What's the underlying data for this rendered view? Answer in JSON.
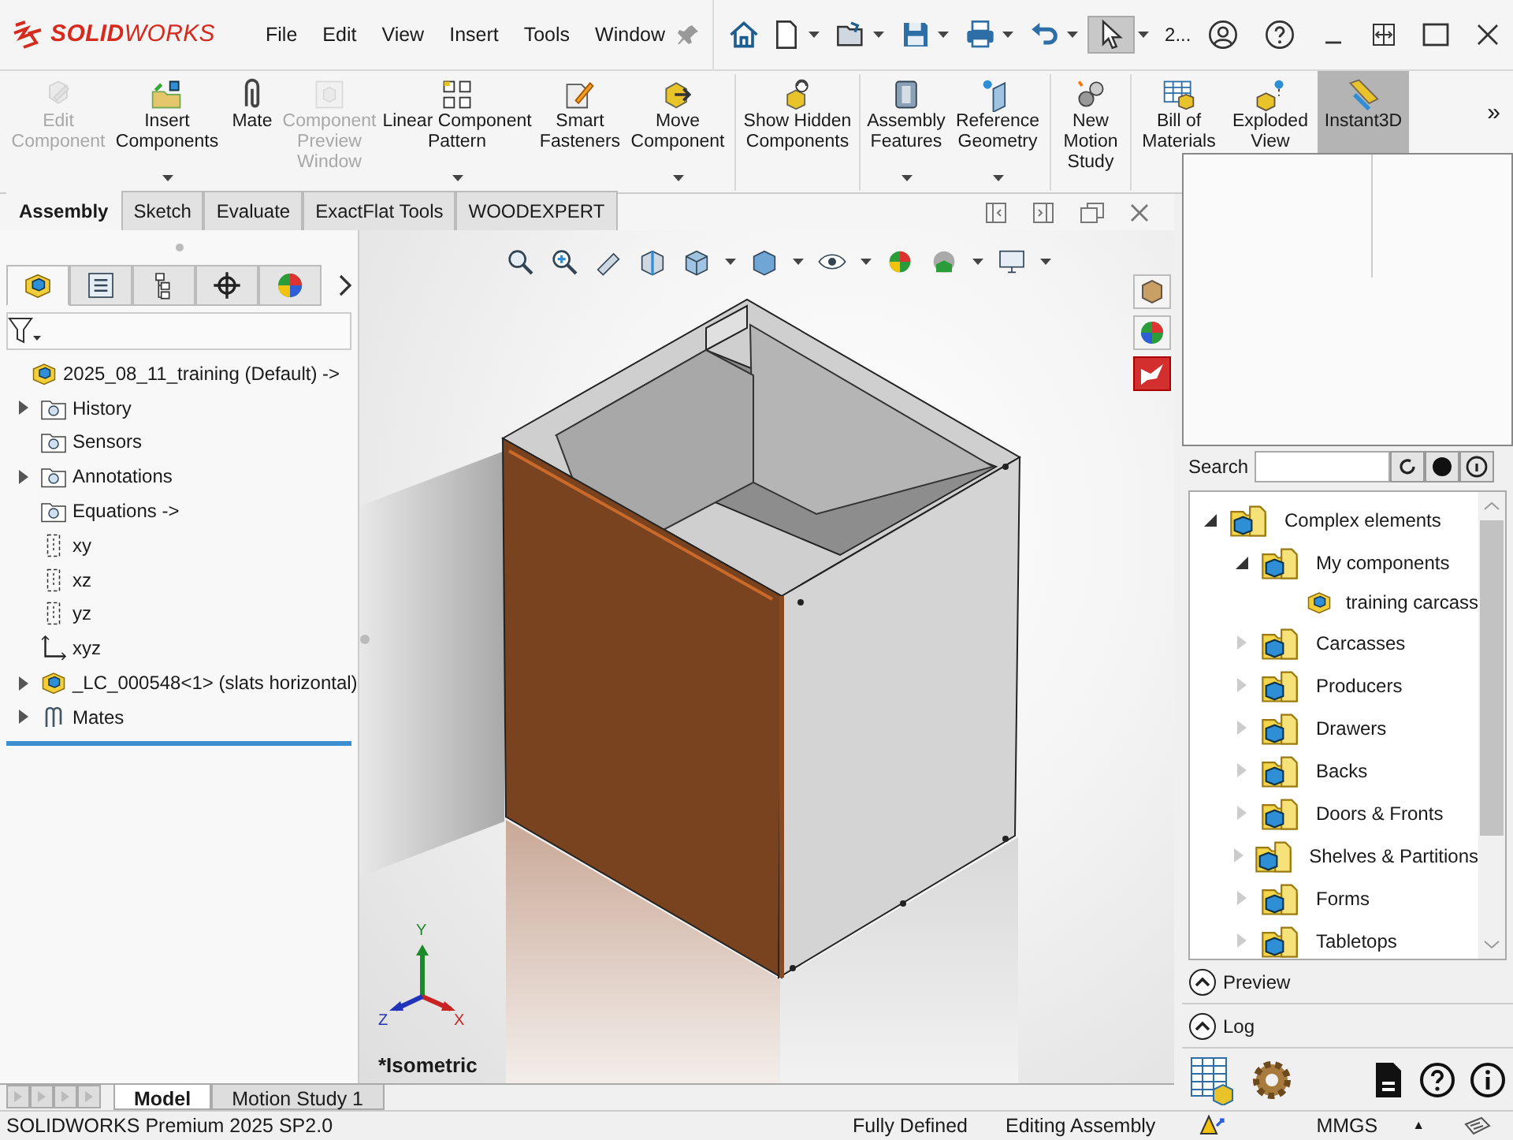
{
  "app": {
    "logo": "**SOLID**WORKS",
    "menu": [
      "File",
      "Edit",
      "View",
      "Insert",
      "Tools",
      "Window"
    ],
    "quick_access": {
      "select_selected": true,
      "document_label": "2..."
    }
  },
  "ribbon": [
    {
      "label": "Edit Component",
      "disabled": true,
      "menu": false,
      "selected": false
    },
    {
      "label": "Insert Components",
      "disabled": false,
      "menu": true,
      "selected": false
    },
    {
      "label": "Mate",
      "disabled": false,
      "menu": false,
      "selected": false
    },
    {
      "label": "Component Preview Window",
      "disabled": true,
      "menu": false,
      "selected": false
    },
    {
      "label": "Linear Component Pattern",
      "disabled": false,
      "menu": true,
      "selected": false
    },
    {
      "label": "Smart Fasteners",
      "disabled": false,
      "menu": false,
      "selected": false
    },
    {
      "label": "Move Component",
      "disabled": false,
      "menu": true,
      "selected": false
    },
    {
      "label": "Show Hidden Components",
      "disabled": false,
      "menu": false,
      "selected": false
    },
    {
      "label": "Assembly Features",
      "disabled": false,
      "menu": true,
      "selected": false
    },
    {
      "label": "Reference Geometry",
      "disabled": false,
      "menu": true,
      "selected": false
    },
    {
      "label": "New Motion Study",
      "disabled": false,
      "menu": false,
      "selected": false
    },
    {
      "label": "Bill of Materials",
      "disabled": false,
      "menu": false,
      "selected": false
    },
    {
      "label": "Exploded View",
      "disabled": false,
      "menu": false,
      "selected": false
    },
    {
      "label": "Instant3D",
      "disabled": false,
      "menu": false,
      "selected": true
    }
  ],
  "ribbon_overflow": "»",
  "command_tabs": [
    {
      "label": "Assembly",
      "selected": true
    },
    {
      "label": "Sketch",
      "selected": false
    },
    {
      "label": "Evaluate",
      "selected": false
    },
    {
      "label": "ExactFlat Tools",
      "selected": false
    },
    {
      "label": "WOODEXPERT",
      "selected": false
    }
  ],
  "feature_manager": {
    "panel_tabs": [
      {
        "selected": true
      },
      {
        "selected": false
      },
      {
        "selected": false
      },
      {
        "selected": false
      },
      {
        "selected": false
      }
    ],
    "tree": [
      {
        "label": "2025_08_11_training (Default) ->",
        "kind": "assembly",
        "children": [
          {
            "label": "History",
            "kind": "folder",
            "expanded": false
          },
          {
            "label": "Sensors",
            "kind": "folder"
          },
          {
            "label": "Annotations",
            "kind": "folder",
            "expanded": false
          },
          {
            "label": "Equations ->",
            "kind": "folder"
          },
          {
            "label": "xy",
            "kind": "plane"
          },
          {
            "label": "xz",
            "kind": "plane"
          },
          {
            "label": "yz",
            "kind": "plane"
          },
          {
            "label": "xyz",
            "kind": "origin"
          },
          {
            "label": "_LC_000548<1> (slats horizontal)",
            "kind": "assembly",
            "expanded": false
          },
          {
            "label": "Mates",
            "kind": "mates",
            "expanded": false
          }
        ]
      }
    ]
  },
  "viewport": {
    "view_label": "*Isometric",
    "triad": {
      "x": "X",
      "y": "Y",
      "z": "Z"
    }
  },
  "design_library": {
    "search_label": "Search",
    "tree": [
      {
        "label": "Complex elements",
        "kind": "folder",
        "expanded": true,
        "children": [
          {
            "label": "My components",
            "kind": "folder",
            "expanded": true,
            "children": [
              {
                "label": "training carcass",
                "kind": "component"
              }
            ]
          },
          {
            "label": "Carcasses",
            "kind": "folder",
            "expanded": false
          },
          {
            "label": "Producers",
            "kind": "folder",
            "expanded": false
          },
          {
            "label": "Drawers",
            "kind": "folder",
            "expanded": false
          },
          {
            "label": "Backs",
            "kind": "folder",
            "expanded": false
          },
          {
            "label": "Doors & Fronts",
            "kind": "folder",
            "expanded": false
          },
          {
            "label": "Shelves & Partitions",
            "kind": "folder",
            "expanded": false
          },
          {
            "label": "Forms",
            "kind": "folder",
            "expanded": false
          },
          {
            "label": "Tabletops",
            "kind": "folder",
            "expanded": false
          }
        ]
      }
    ],
    "sections": [
      {
        "label": "Preview",
        "expanded": false
      },
      {
        "label": "Log",
        "expanded": false
      }
    ]
  },
  "sheet_tabs": [
    {
      "label": "Model",
      "selected": true
    },
    {
      "label": "Motion Study 1",
      "selected": false
    }
  ],
  "status_bar": {
    "product": "SOLIDWORKS Premium 2025 SP2.0",
    "state": "Fully Defined",
    "mode": "Editing Assembly",
    "units": "MMGS",
    "units_caret": "▲"
  }
}
